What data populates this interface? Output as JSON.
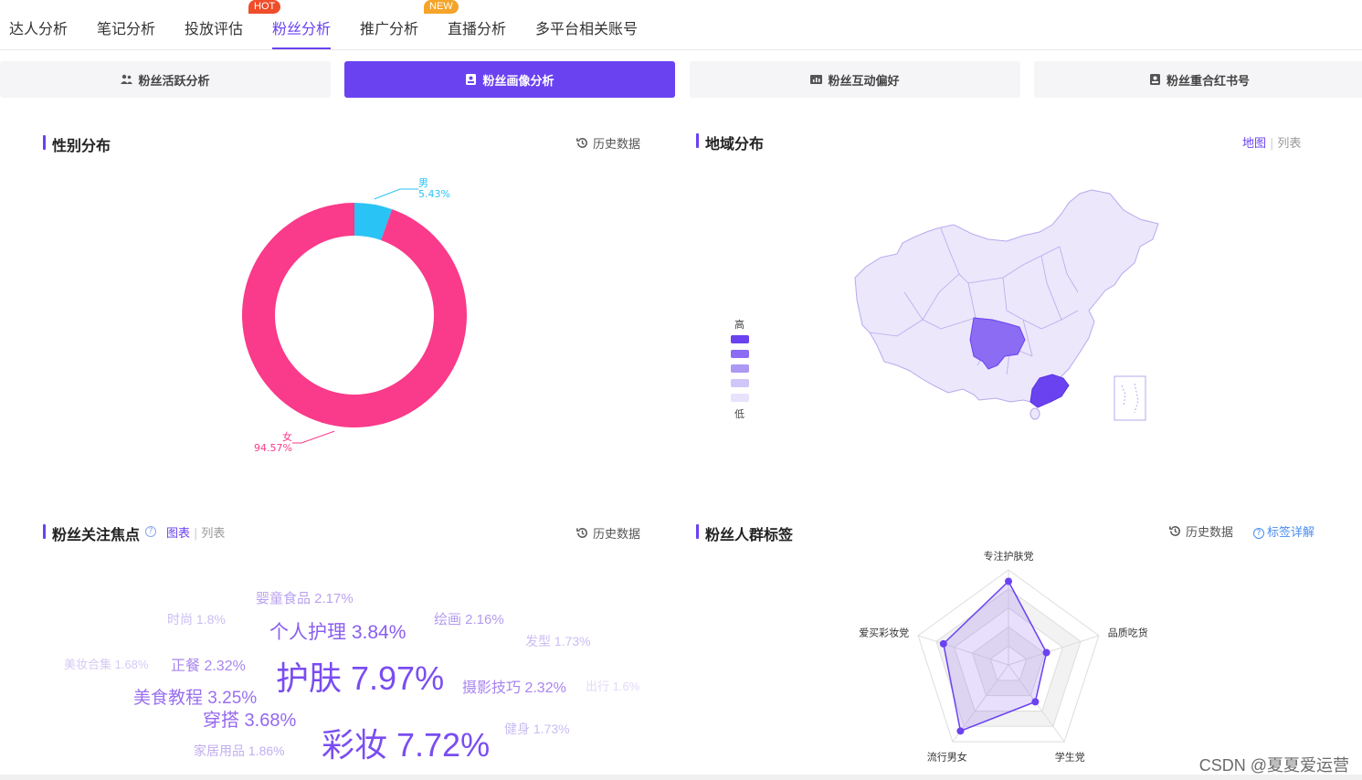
{
  "nav": {
    "tabs": [
      {
        "label": "达人分析"
      },
      {
        "label": "笔记分析"
      },
      {
        "label": "投放评估"
      },
      {
        "label": "粉丝分析",
        "badge": "HOT",
        "active": true
      },
      {
        "label": "推广分析",
        "badge": "NEW"
      },
      {
        "label": "直播分析"
      },
      {
        "label": "多平台相关账号"
      }
    ]
  },
  "subtabs": [
    {
      "label": "粉丝活跃分析",
      "icon": "fans-icon"
    },
    {
      "label": "粉丝画像分析",
      "icon": "portrait-icon",
      "active": true
    },
    {
      "label": "粉丝互动偏好",
      "icon": "chart-icon"
    },
    {
      "label": "粉丝重合红书号",
      "icon": "account-icon"
    }
  ],
  "gender": {
    "title": "性别分布",
    "history": "历史数据",
    "chart_data": {
      "type": "pie",
      "categories": [
        "男",
        "女"
      ],
      "values": [
        5.43,
        94.57
      ],
      "value_labels": [
        "5.43%",
        "94.57%"
      ],
      "colors": [
        "#29c3f5",
        "#fa3a8a"
      ]
    }
  },
  "region": {
    "title": "地域分布",
    "toggle_on": "地图",
    "toggle_off": "列表",
    "legend_high": "高",
    "legend_low": "低",
    "legend_colors": [
      "#6a42f0",
      "#8b6cf2",
      "#ad98f4",
      "#d1c6f8",
      "#e8e2fb"
    ],
    "highlight_regions": [
      "四川",
      "广东"
    ]
  },
  "focus": {
    "title": "粉丝关注焦点",
    "toggle_on": "图表",
    "toggle_off": "列表",
    "history": "历史数据",
    "words": [
      {
        "text": "婴童食品 2.17%"
      },
      {
        "text": "时尚 1.8%"
      },
      {
        "text": "个人护理 3.84%"
      },
      {
        "text": "绘画 2.16%"
      },
      {
        "text": "发型 1.73%"
      },
      {
        "text": "美妆合集 1.68%"
      },
      {
        "text": "正餐 2.32%"
      },
      {
        "text": "护肤 7.97%"
      },
      {
        "text": "摄影技巧 2.32%"
      },
      {
        "text": "出行 1.6%"
      },
      {
        "text": "美食教程 3.25%"
      },
      {
        "text": "穿搭 3.68%"
      },
      {
        "text": "家居用品 1.86%"
      },
      {
        "text": "彩妆 7.72%"
      },
      {
        "text": "健身 1.73%"
      }
    ]
  },
  "crowd": {
    "title": "粉丝人群标签",
    "history": "历史数据",
    "help": "标签详解",
    "chart_data": {
      "type": "radar",
      "categories": [
        "专注护肤党",
        "品质吃货",
        "学生党",
        "流行男女",
        "爱买彩妆党"
      ],
      "values": [
        0.88,
        0.42,
        0.48,
        0.86,
        0.72
      ],
      "max": 1
    }
  },
  "watermark": "CSDN @夏夏爱运营"
}
